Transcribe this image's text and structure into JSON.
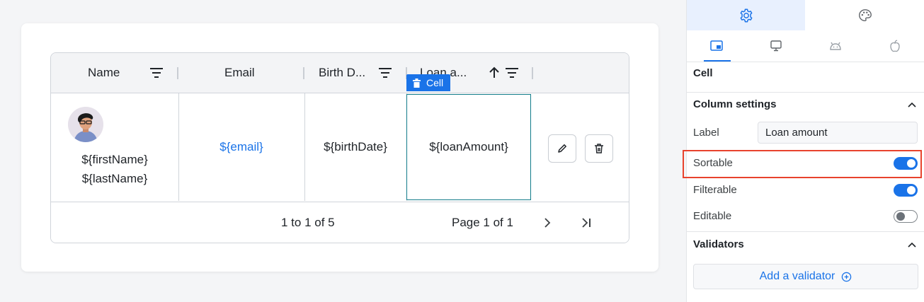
{
  "table": {
    "columns": [
      {
        "label": "Name"
      },
      {
        "label": "Email"
      },
      {
        "label": "Birth D..."
      },
      {
        "label": "Loan a..."
      }
    ],
    "row": {
      "first_name": "${firstName}",
      "last_name": "${lastName}",
      "email": "${email}",
      "birth_date": "${birthDate}",
      "loan_amount": "${loanAmount}"
    },
    "cell_badge": "Cell",
    "footer": {
      "range": "1 to 1 of 5",
      "page": "Page 1 of 1"
    }
  },
  "panel": {
    "section_cell": "Cell",
    "column_settings": "Column settings",
    "label_field_label": "Label",
    "label_value": "Loan amount",
    "sortable_label": "Sortable",
    "sortable_on": true,
    "filterable_label": "Filterable",
    "filterable_on": true,
    "editable_label": "Editable",
    "editable_on": false,
    "validators": "Validators",
    "add_validator": "Add a validator"
  },
  "colors": {
    "accent": "#1a73e8",
    "selection_border": "#127c8a",
    "highlight": "#e8432d"
  },
  "icons": [
    "settings-gear-icon",
    "palette-icon",
    "desktop-layout-icon",
    "monitor-icon",
    "android-icon",
    "apple-icon",
    "filter-icon",
    "arrow-up-icon",
    "trash-icon",
    "pencil-icon",
    "chevron-right-icon",
    "last-page-icon",
    "chevron-up-icon",
    "plus-circle-icon"
  ]
}
